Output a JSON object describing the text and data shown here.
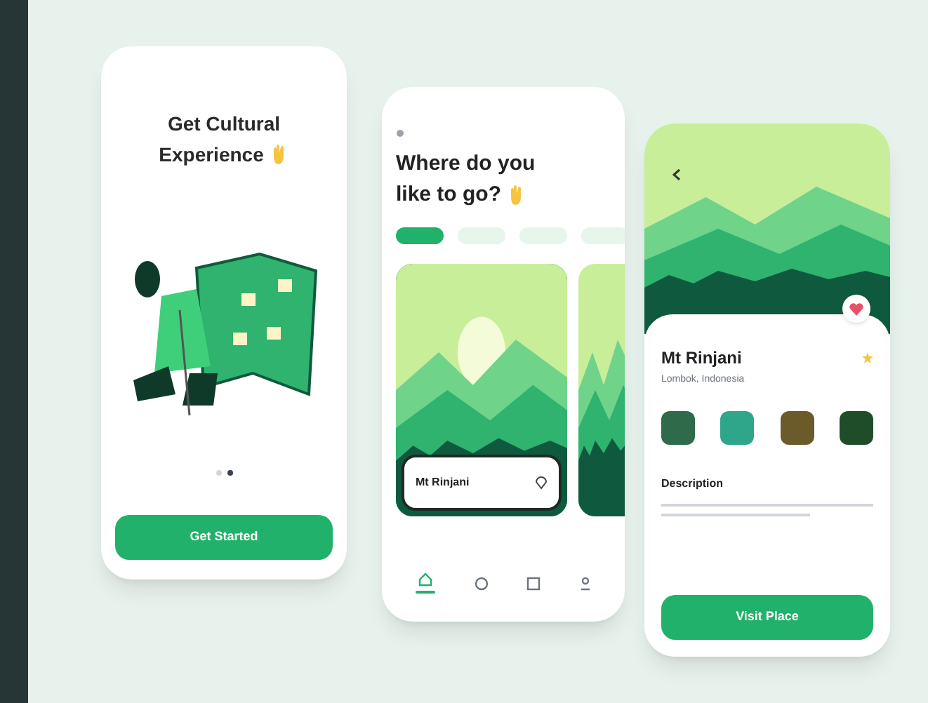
{
  "onboarding": {
    "title_lines": [
      "Get Cultural",
      "Experience"
    ],
    "pager": [
      {
        "selected": false
      },
      {
        "selected": true
      }
    ],
    "button": "Get Started"
  },
  "explore": {
    "title_lines": [
      "Where do you",
      "like to go?"
    ],
    "chips": [
      {
        "selected": true
      },
      {
        "selected": false
      },
      {
        "selected": false
      },
      {
        "selected": false
      }
    ],
    "card": {
      "name": "Mt Rinjani"
    },
    "nav": [
      {
        "kind": "home",
        "selected": true
      },
      {
        "kind": "search",
        "selected": false
      },
      {
        "kind": "bookmark",
        "selected": false
      },
      {
        "kind": "profile",
        "selected": false
      }
    ]
  },
  "detail": {
    "name": "Mt Rinjani",
    "location": "Lombok, Indonesia",
    "favorite": true,
    "thumbnails": [
      {
        "color": "#2f6b4a"
      },
      {
        "color": "#2fa58a"
      },
      {
        "color": "#6b5a2a"
      },
      {
        "color": "#1f4d2a"
      }
    ],
    "description_heading": "Description",
    "button": "Visit Place"
  }
}
